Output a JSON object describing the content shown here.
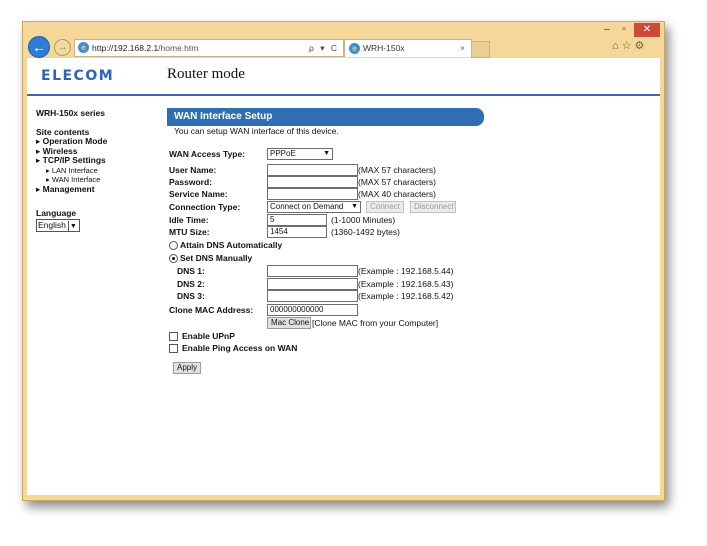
{
  "browser": {
    "address_host": "http://192.168.2.1",
    "address_path": "/home.htm",
    "address_controls": "ρ ▾ C",
    "tab_title": "WRH-150x",
    "tab_close": "×"
  },
  "header": {
    "logo": "ELECOM",
    "page_title": "Router mode"
  },
  "sidebar": {
    "series": "WRH-150x series",
    "contents_label": "Site contents",
    "items": [
      {
        "label": "▸ Operation Mode"
      },
      {
        "label": "▸ Wireless"
      },
      {
        "label": "▸ TCP/IP Settings"
      },
      {
        "label": "▸ LAN Interface"
      },
      {
        "label": "▸ WAN Interface"
      },
      {
        "label": "▸ Management"
      }
    ],
    "language_label": "Language",
    "language_value": "English"
  },
  "main": {
    "title": "WAN Interface Setup",
    "description": "You can setup WAN interface of this device.",
    "access_type_label": "WAN Access Type:",
    "access_type_value": "PPPoE",
    "user_name_label": "User Name:",
    "user_name_value": "",
    "user_name_hint": "(MAX 57 characters)",
    "password_label": "Password:",
    "password_value": "",
    "password_hint": "(MAX 57 characters)",
    "service_name_label": "Service Name:",
    "service_name_value": "",
    "service_name_hint": "(MAX 40 characters)",
    "connection_type_label": "Connection Type:",
    "connection_type_value": "Connect on Demand",
    "connect_button": "Connect",
    "disconnect_button": "Disconnect",
    "idle_time_label": "Idle Time:",
    "idle_time_value": "5",
    "idle_time_hint": "(1-1000 Minutes)",
    "mtu_label": "MTU Size:",
    "mtu_value": "1454",
    "mtu_hint": "(1360-1492 bytes)",
    "dns_auto_label": "Attain DNS Automatically",
    "dns_manual_label": "Set DNS Manually",
    "dns1_label": "DNS 1:",
    "dns1_value": "",
    "dns1_hint": "(Example : 192.168.5.44)",
    "dns2_label": "DNS 2:",
    "dns2_value": "",
    "dns2_hint": "(Example : 192.168.5.43)",
    "dns3_label": "DNS 3:",
    "dns3_value": "",
    "dns3_hint": "(Example : 192.168.5.42)",
    "clone_mac_label": "Clone MAC Address:",
    "clone_mac_value": "000000000000",
    "mac_clone_button": "Mac Clone",
    "mac_clone_hint": "[Clone MAC from your Computer]",
    "upnp_label": "Enable UPnP",
    "ping_label": "Enable Ping Access on WAN",
    "apply_button": "Apply"
  },
  "colors": {
    "accent": "#2f6db5",
    "window_frame": "#f5d79a",
    "close_button": "#c94b3a"
  }
}
